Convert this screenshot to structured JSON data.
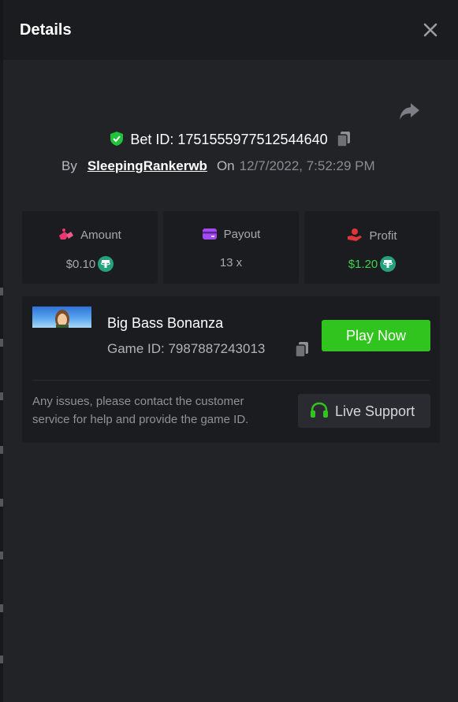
{
  "header": {
    "title": "Details"
  },
  "bet": {
    "id_label": "Bet ID: 1751555977512544640",
    "by_label": "By",
    "username": "SleepingRankerwb",
    "on_label": "On",
    "datetime": "12/7/2022, 7:52:29 PM"
  },
  "stats": {
    "amount": {
      "label": "Amount",
      "value": "$0.10"
    },
    "payout": {
      "label": "Payout",
      "value": "13 x"
    },
    "profit": {
      "label": "Profit",
      "value": "$1.20"
    }
  },
  "game": {
    "name": "Big Bass Bonanza",
    "id_label": "Game ID: 7987887243013",
    "play_label": "Play Now"
  },
  "support": {
    "notice": "Any issues, please contact the customer service for help and provide the game ID.",
    "button_label": "Live Support"
  },
  "colors": {
    "accent_green": "#32c41e",
    "profit_green": "#3fd14d",
    "amount_icon": "#e8386e",
    "payout_icon": "#a24af2",
    "profit_icon": "#e0363a",
    "tether": "#26a17b"
  },
  "icons": [
    "close-icon",
    "share-icon",
    "shield-check-icon",
    "copy-icon",
    "amount-icon",
    "payout-card-icon",
    "profit-hand-icon",
    "tether-icon",
    "headset-icon"
  ]
}
